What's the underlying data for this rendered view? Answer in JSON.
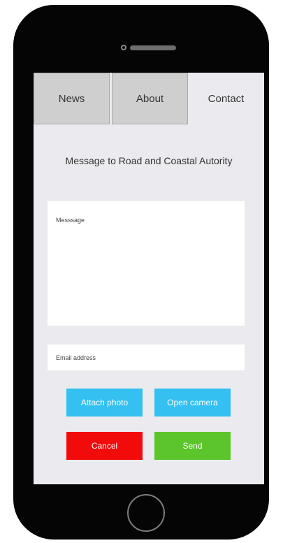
{
  "tabs": {
    "news": "News",
    "about": "About",
    "contact": "Contact",
    "active": "Contact"
  },
  "page": {
    "title": "Message to Road and Coastal Autority"
  },
  "form": {
    "message_placeholder": "Messsage",
    "message_value": "",
    "email_placeholder": "Email address",
    "email_value": ""
  },
  "buttons": {
    "attach_photo": "Attach photo",
    "open_camera": "Open camera",
    "cancel": "Cancel",
    "send": "Send"
  },
  "colors": {
    "phone_body": "#050505",
    "screen_background": "#ebebef",
    "inactive_tab": "#cfcfcf",
    "primary_button": "#34c0f0",
    "cancel_button": "#f20b0b",
    "send_button": "#5cc52b"
  },
  "icons": {
    "camera": "front-camera-icon",
    "speaker": "speaker-icon",
    "home": "home-button-icon"
  }
}
